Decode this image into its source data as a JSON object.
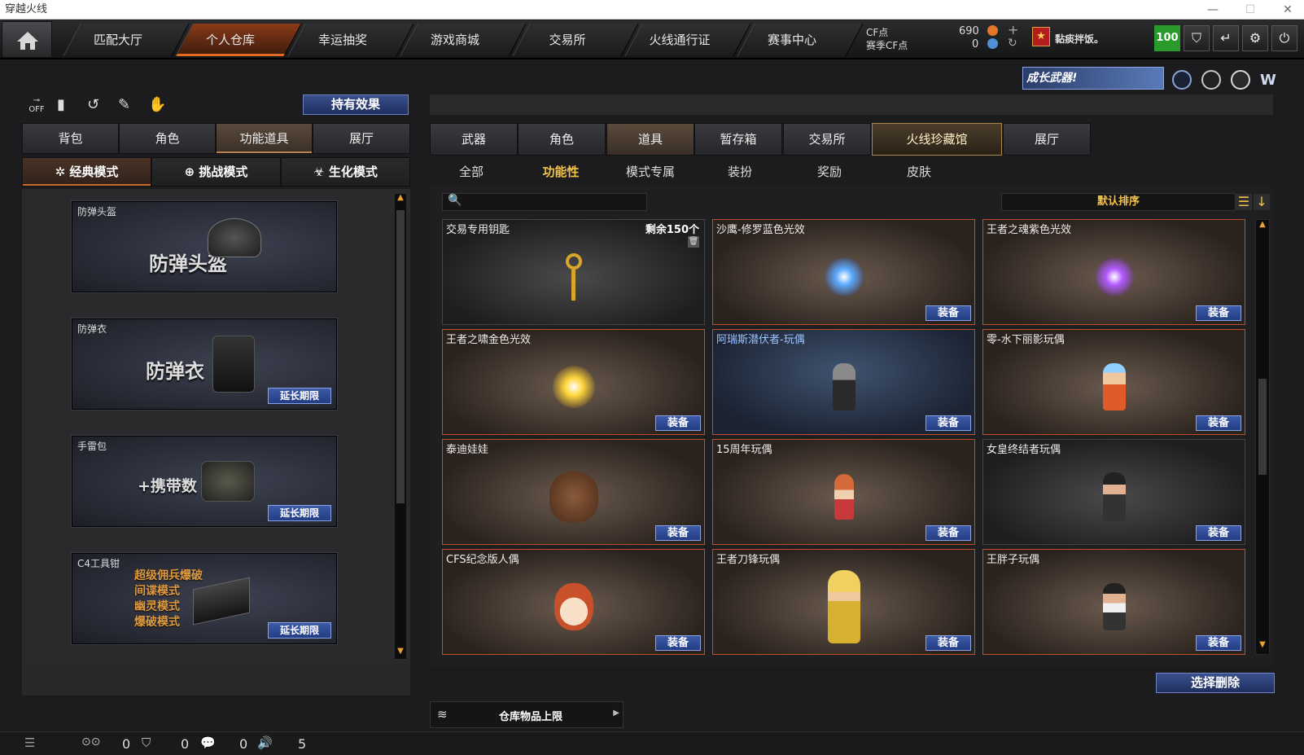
{
  "window": {
    "title": "穿越火线"
  },
  "nav": {
    "tabs": [
      "匹配大厅",
      "个人仓库",
      "幸运抽奖",
      "游戏商城",
      "交易所",
      "火线通行证",
      "赛事中心"
    ]
  },
  "currency": {
    "cf_label": "CF点",
    "season_label": "赛季CF点",
    "cf_value": "690",
    "season_value": "0"
  },
  "user": {
    "name": "黏痰拌饭。",
    "level_badge": "100"
  },
  "banner": {
    "text": "成长武器!"
  },
  "left": {
    "hold_effect": "持有效果",
    "tabs": [
      "背包",
      "角色",
      "功能道具",
      "展厅"
    ],
    "modes": [
      "经典模式",
      "挑战模式",
      "生化模式"
    ],
    "cards": [
      {
        "title": "防弹头盔",
        "big": "防弹头盔"
      },
      {
        "title": "防弹衣",
        "big": "防弹衣",
        "button": "延长期限"
      },
      {
        "title": "手雷包",
        "big": "+携带数",
        "button": "延长期限"
      },
      {
        "title": "C4工具钳",
        "lines": [
          "超级佣兵爆破",
          "间谍模式",
          "幽灵模式",
          "爆破模式"
        ],
        "button": "延长期限"
      }
    ]
  },
  "right": {
    "tabs": [
      "武器",
      "角色",
      "道具",
      "暂存箱",
      "交易所",
      "火线珍藏馆",
      "展厅"
    ],
    "subtabs": [
      "全部",
      "功能性",
      "模式专属",
      "装扮",
      "奖励",
      "皮肤"
    ],
    "sort_label": "默认排序",
    "search_placeholder": "",
    "equip_label": "装备",
    "items": [
      {
        "name": "交易专用钥匙",
        "remain": "剩余150个"
      },
      {
        "name": "沙鹰-修罗蓝色光效"
      },
      {
        "name": "王者之魂紫色光效"
      },
      {
        "name": "王者之啸金色光效"
      },
      {
        "name": "阿瑞斯潜伏者-玩偶"
      },
      {
        "name": "零-水下丽影玩偶"
      },
      {
        "name": "泰迪娃娃"
      },
      {
        "name": "15周年玩偶"
      },
      {
        "name": "女皇终结者玩偶"
      },
      {
        "name": "CFS纪念版人偶"
      },
      {
        "name": "王者刀锋玩偶"
      },
      {
        "name": "王胖子玩偶"
      }
    ],
    "select_delete": "选择删除",
    "capacity_label": "仓库物品上限"
  },
  "status": {
    "friends": "0",
    "clan": "0",
    "chat": "0",
    "voice": "5"
  }
}
